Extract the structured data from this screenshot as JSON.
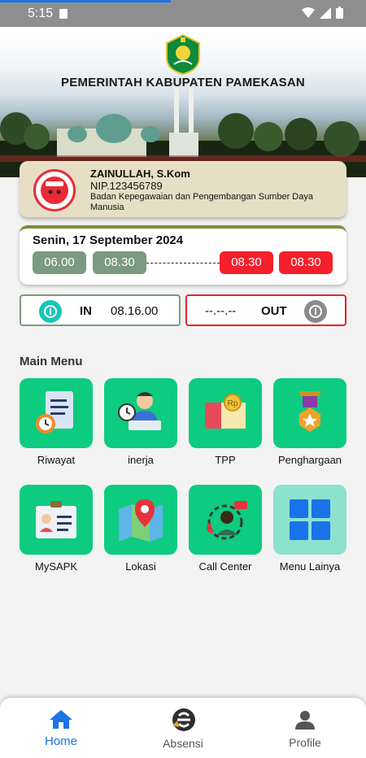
{
  "status_bar": {
    "time": "5:15"
  },
  "header": {
    "title": "PEMERINTAH KABUPATEN PAMEKASAN",
    "logo_icon": "pamekasan-emblem-icon"
  },
  "profile": {
    "name": "ZAINULLAH, S.Kom",
    "nip": "NIP.123456789",
    "department": "Badan Kepegawaian dan Pengembangan Sumber Daya Manusia"
  },
  "schedule": {
    "date": "Senin, 17 September 2024",
    "times": [
      "06.00",
      "08.30",
      "08.30",
      "08.30"
    ]
  },
  "attendance": {
    "in_label": "IN",
    "in_time": "08.16.00",
    "out_label": "OUT",
    "out_time": "--.--.--"
  },
  "main_menu": {
    "title": "Main Menu",
    "items": [
      {
        "label": "Riwayat",
        "icon": "document-clock-icon"
      },
      {
        "label": "inerja",
        "icon": "worker-laptop-icon"
      },
      {
        "label": "TPP",
        "icon": "money-rp-icon"
      },
      {
        "label": "Penghargaan",
        "icon": "medal-icon"
      },
      {
        "label": "MySAPK",
        "icon": "id-card-icon"
      },
      {
        "label": "Lokasi",
        "icon": "map-pin-icon"
      },
      {
        "label": "Call Center",
        "icon": "call-center-icon"
      },
      {
        "label": "Menu Lainya",
        "icon": "grid-icon"
      }
    ]
  },
  "bottom_nav": {
    "items": [
      {
        "label": "Home",
        "icon": "home-icon",
        "active": true
      },
      {
        "label": "Absensi",
        "icon": "absensi-logo-icon",
        "active": false
      },
      {
        "label": "Profile",
        "icon": "person-icon",
        "active": false
      }
    ]
  },
  "colors": {
    "accent_green": "#0dcc7f",
    "accent_red": "#f4202b",
    "accent_blue": "#1a73e8",
    "muted_green": "#7b9a7f",
    "profile_bg": "#e6dfc6"
  }
}
